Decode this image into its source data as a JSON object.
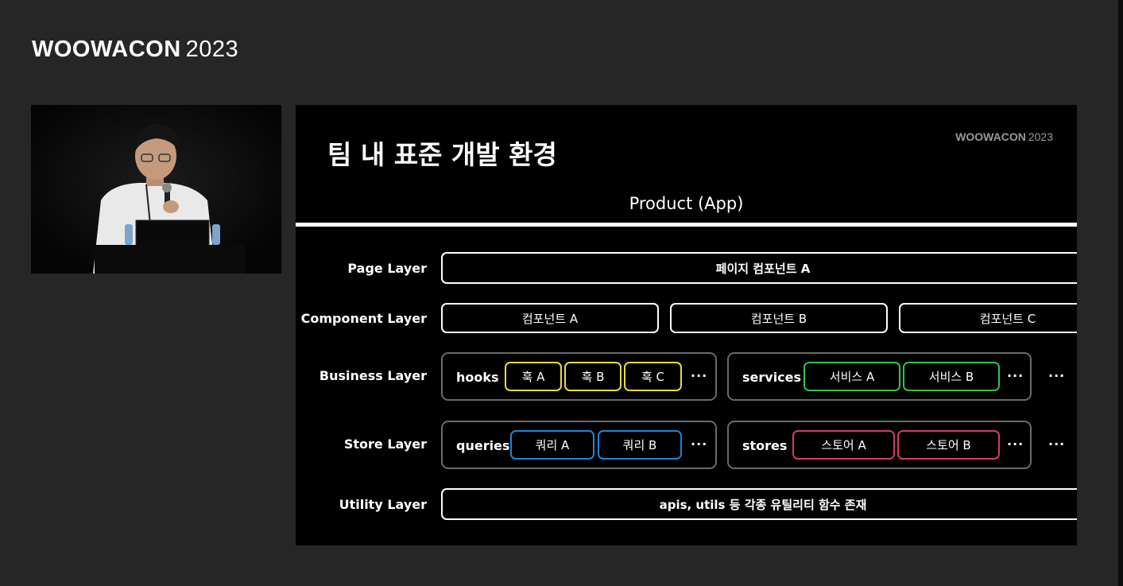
{
  "header": {
    "brand": "WOOWACON",
    "year": "2023"
  },
  "slide": {
    "title": "팀 내 표준 개발 환경",
    "brand": "WOOWACON",
    "brand_year": "2023",
    "product": "Product (App)",
    "layers": {
      "page": {
        "label": "Page Layer",
        "box": "페이지 컴포넌트 A"
      },
      "component": {
        "label": "Component Layer",
        "boxes": [
          "컴포넌트 A",
          "컴포넌트 B",
          "컴포넌트 C"
        ]
      },
      "business": {
        "label": "Business Layer",
        "hooks": {
          "label": "hooks",
          "items": [
            "훅 A",
            "훅 B",
            "훅 C"
          ],
          "more": "···"
        },
        "services": {
          "label": "services",
          "items": [
            "서비스 A",
            "서비스 B"
          ],
          "more": "···"
        },
        "more": "···"
      },
      "store": {
        "label": "Store Layer",
        "queries": {
          "label": "queries",
          "items": [
            "쿼리 A",
            "쿼리 B"
          ],
          "more": "···"
        },
        "stores": {
          "label": "stores",
          "items": [
            "스토어 A",
            "스토어 B"
          ],
          "more": "···"
        },
        "more": "···"
      },
      "utility": {
        "label": "Utility Layer",
        "box": "apis, utils 등 각종 유틸리티 함수 존재"
      }
    },
    "colors": {
      "hook": "#e6dc3c",
      "service": "#2ec44f",
      "query": "#1f84d6",
      "store": "#d63a63",
      "group_border": "#6a6a6a"
    }
  }
}
